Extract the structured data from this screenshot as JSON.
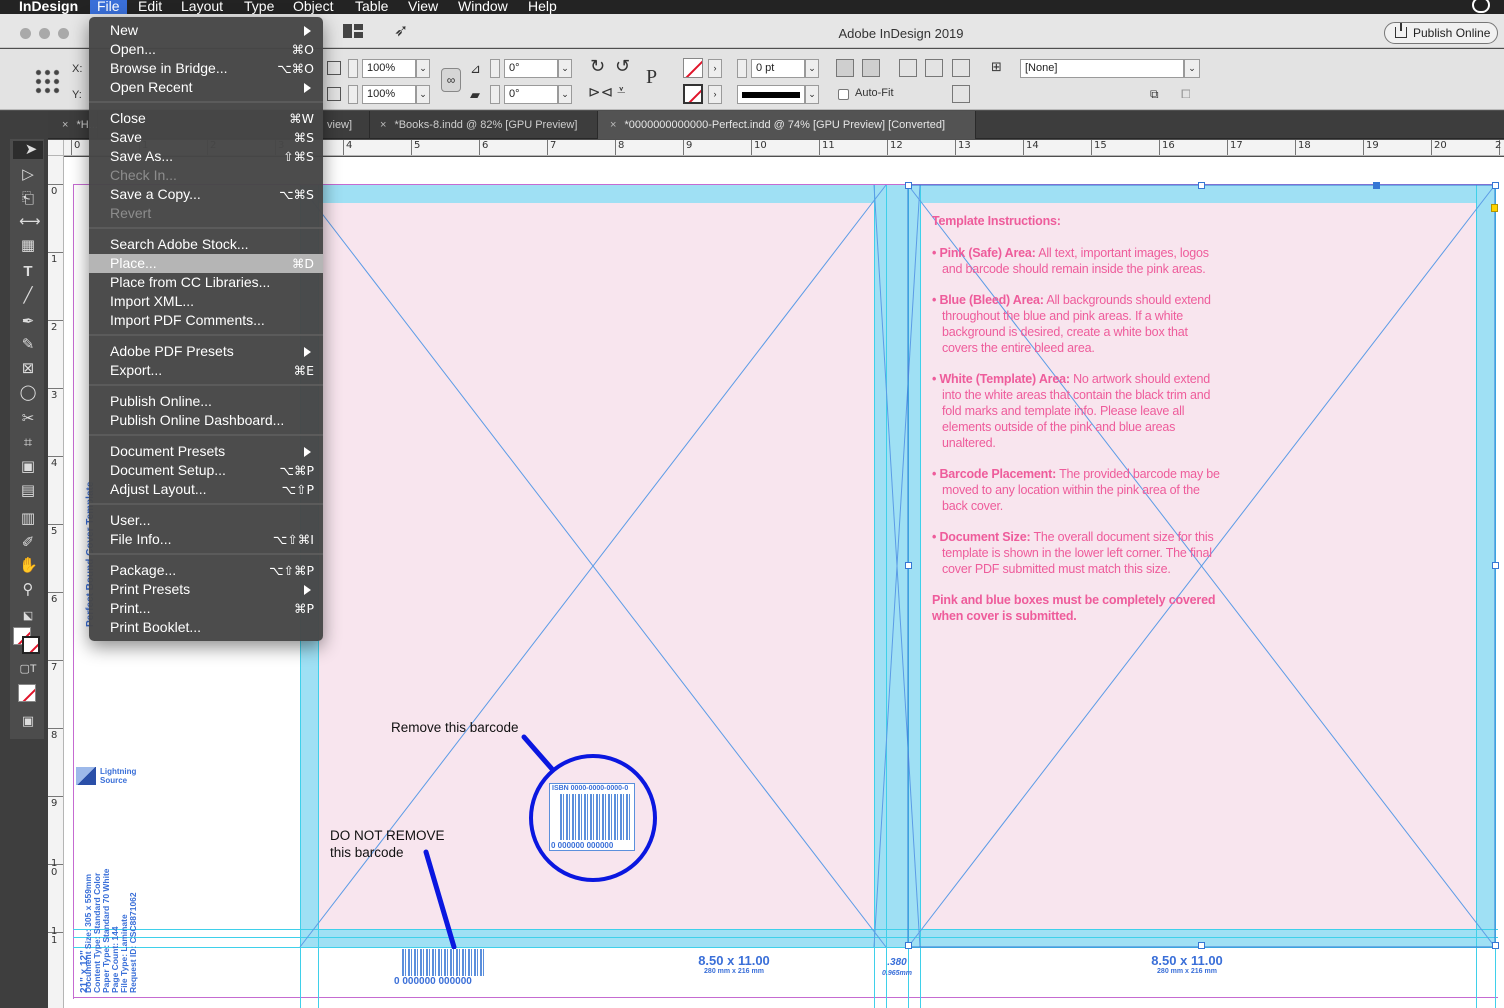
{
  "menubar": {
    "app": "InDesign",
    "items": [
      "File",
      "Edit",
      "Layout",
      "Type",
      "Object",
      "Table",
      "View",
      "Window",
      "Help"
    ]
  },
  "window": {
    "title": "Adobe InDesign 2019",
    "publish_button": "Publish Online"
  },
  "control": {
    "x_label": "X:",
    "y_label": "Y:",
    "scale_x": "100%",
    "scale_y": "100%",
    "rotate": "0°",
    "shear": "0°",
    "stroke_weight": "0 pt",
    "autofit_label": "Auto-Fit",
    "object_style": "[None]"
  },
  "tabs": [
    {
      "label": "*H..."
    },
    {
      "label": "view]"
    },
    {
      "label": "*Books-8.indd @ 82% [GPU Preview]"
    },
    {
      "label": "*0000000000000-Perfect.indd @ 74% [GPU Preview] [Converted]"
    }
  ],
  "ruler_top": [
    "0",
    "1",
    "2",
    "3",
    "4",
    "5",
    "6",
    "7",
    "8",
    "9",
    "10",
    "11",
    "12",
    "13",
    "14",
    "15",
    "16",
    "17",
    "18",
    "19",
    "20",
    "2"
  ],
  "ruler_left": [
    "0",
    "1",
    "2",
    "3",
    "4",
    "5",
    "6",
    "7",
    "8",
    "9",
    "1\n0",
    "1\n1"
  ],
  "file_menu": {
    "items": [
      {
        "label": "New",
        "shortcut": "",
        "submenu": true
      },
      {
        "label": "Open...",
        "shortcut": "⌘O"
      },
      {
        "label": "Browse in Bridge...",
        "shortcut": "⌥⌘O"
      },
      {
        "label": "Open Recent",
        "shortcut": "",
        "submenu": true
      },
      {
        "label": "Close",
        "shortcut": "⌘W"
      },
      {
        "label": "Save",
        "shortcut": "⌘S"
      },
      {
        "label": "Save As...",
        "shortcut": "⇧⌘S"
      },
      {
        "label": "Check In...",
        "shortcut": "",
        "disabled": true
      },
      {
        "label": "Save a Copy...",
        "shortcut": "⌥⌘S"
      },
      {
        "label": "Revert",
        "shortcut": "",
        "disabled": true
      },
      {
        "label": "Search Adobe Stock...",
        "shortcut": ""
      },
      {
        "label": "Place...",
        "shortcut": "⌘D",
        "highlighted": true
      },
      {
        "label": "Place from CC Libraries...",
        "shortcut": ""
      },
      {
        "label": "Import XML...",
        "shortcut": ""
      },
      {
        "label": "Import PDF Comments...",
        "shortcut": ""
      },
      {
        "label": "Adobe PDF Presets",
        "shortcut": "",
        "submenu": true
      },
      {
        "label": "Export...",
        "shortcut": "⌘E"
      },
      {
        "label": "Publish Online...",
        "shortcut": ""
      },
      {
        "label": "Publish Online Dashboard...",
        "shortcut": ""
      },
      {
        "label": "Document Presets",
        "shortcut": "",
        "submenu": true
      },
      {
        "label": "Document Setup...",
        "shortcut": "⌥⌘P"
      },
      {
        "label": "Adjust Layout...",
        "shortcut": "⌥⇧P"
      },
      {
        "label": "User...",
        "shortcut": ""
      },
      {
        "label": "File Info...",
        "shortcut": "⌥⇧⌘I"
      },
      {
        "label": "Package...",
        "shortcut": "⌥⇧⌘P"
      },
      {
        "label": "Print Presets",
        "shortcut": "",
        "submenu": true
      },
      {
        "label": "Print...",
        "shortcut": "⌘P"
      },
      {
        "label": "Print Booklet...",
        "shortcut": ""
      }
    ]
  },
  "document": {
    "instructions_title": "Template Instructions:",
    "instructions": [
      {
        "head": "Pink (Safe) Area:",
        "body": " All text, important images, logos and barcode should remain inside the pink areas."
      },
      {
        "head": "Blue (Bleed) Area:",
        "body": " All backgrounds should extend throughout the blue and pink areas. If a white background is desired, create a white box that covers the entire bleed area."
      },
      {
        "head": "White (Template) Area:",
        "body": " No artwork should extend into the white areas that contain the black trim and fold marks and template info. Please leave all elements outside of the pink and blue areas unaltered."
      },
      {
        "head": "Barcode Placement:",
        "body": " The provided barcode may be moved to any location within the pink area of the back cover."
      },
      {
        "head": "Document Size:",
        "body": " The overall document size for this template is shown in the lower left corner. The final cover PDF submitted must match this size."
      }
    ],
    "closing_note": "Pink and blue boxes must be completely covered when cover is submitted.",
    "annotation_remove": "Remove this barcode",
    "annotation_keep": "DO NOT REMOVE\nthis barcode",
    "trim_back": "8.50 x 11.00",
    "trim_back_mm": "280 mm x 216 mm",
    "trim_front": "8.50 x 11.00",
    "trim_front_mm": "280 mm x 216 mm",
    "spine_width": ".380",
    "spine_mm": "0.965mm",
    "barcode_isbn": "ISBN 0000-0000-0000-0",
    "barcode_digits": "0  000000  000000",
    "barcode_small_digits": "0  000000  000000",
    "logo_text": "Lightning Source",
    "vertical_info_title": "Perfect Bound Cover Template",
    "vertical_info": "Document Size: 305 x 559mm\nContent Type: Standard Color\nPaper Type: Standard 70 White\nPage Count: 144\nFile Type: Laminate\nRequest ID: CSC8871062",
    "vertical_size": "21\" x 12\""
  },
  "colors": {
    "pink_area": "#f8e5ee",
    "bleed_blue": "#9fe0f4",
    "instruction_text": "#ee5c9b",
    "annotation_blue": "#0a17e0",
    "menu_highlight": "#b5b5b5"
  }
}
